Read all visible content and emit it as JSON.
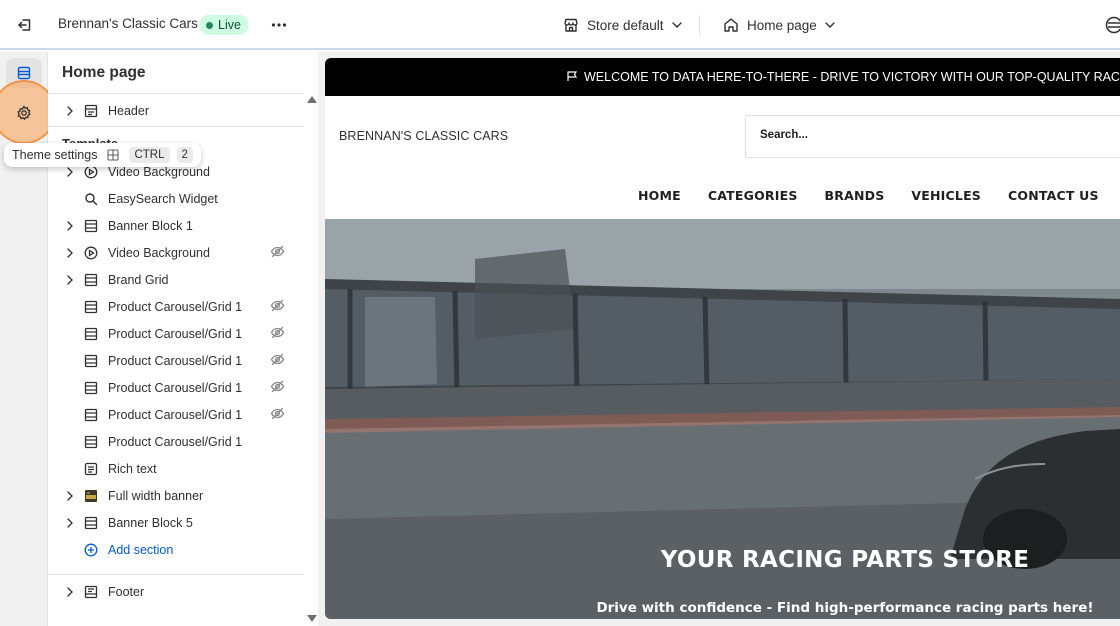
{
  "topbar": {
    "store_name": "Brennan's Classic Cars",
    "live_label": "Live",
    "store_dropdown": "Store default",
    "page_dropdown": "Home page",
    "colors": {
      "live_bg": "#cdfee1",
      "live_text": "#0c5132"
    }
  },
  "tooltip": {
    "label": "Theme settings",
    "shortcut_key": "CTRL",
    "shortcut_num": "2"
  },
  "sidebar": {
    "title": "Home page",
    "header_item": "Header",
    "templates_label": "Template",
    "items": [
      {
        "label": "Video Background",
        "icon": "play-circle-icon",
        "expandable": true,
        "hidden": false
      },
      {
        "label": "EasySearch Widget",
        "icon": "search-icon",
        "expandable": false,
        "hidden": false
      },
      {
        "label": "Banner Block 1",
        "icon": "section-icon",
        "expandable": true,
        "hidden": false
      },
      {
        "label": "Video Background",
        "icon": "play-circle-icon",
        "expandable": true,
        "hidden": true
      },
      {
        "label": "Brand Grid",
        "icon": "section-icon",
        "expandable": true,
        "hidden": false
      },
      {
        "label": "Product Carousel/Grid 1",
        "icon": "section-icon",
        "expandable": false,
        "hidden": true
      },
      {
        "label": "Product Carousel/Grid 1",
        "icon": "section-icon",
        "expandable": false,
        "hidden": true
      },
      {
        "label": "Product Carousel/Grid 1",
        "icon": "section-icon",
        "expandable": false,
        "hidden": true
      },
      {
        "label": "Product Carousel/Grid 1",
        "icon": "section-icon",
        "expandable": false,
        "hidden": true
      },
      {
        "label": "Product Carousel/Grid 1",
        "icon": "section-icon",
        "expandable": false,
        "hidden": true
      },
      {
        "label": "Product Carousel/Grid 1",
        "icon": "section-icon",
        "expandable": false,
        "hidden": false
      },
      {
        "label": "Rich text",
        "icon": "text-block-icon",
        "expandable": false,
        "hidden": false
      },
      {
        "label": "Full width banner",
        "icon": "image-thumbnail-icon",
        "expandable": true,
        "hidden": false
      },
      {
        "label": "Banner Block 5",
        "icon": "section-icon",
        "expandable": true,
        "hidden": false
      }
    ],
    "add_section": "Add section",
    "footer_item": "Footer"
  },
  "preview": {
    "announcement": "WELCOME TO DATA HERE-TO-THERE - DRIVE TO VICTORY WITH OUR TOP-QUALITY RACING PARTS!",
    "logo_text": "BRENNAN'S CLASSIC CARS",
    "search_placeholder": "Search...",
    "nav": [
      "HOME",
      "CATEGORIES",
      "BRANDS",
      "VEHICLES",
      "CONTACT US"
    ],
    "hero_title": "YOUR RACING PARTS STORE",
    "hero_subtitle": "Drive with confidence - Find high-performance racing parts here!"
  }
}
